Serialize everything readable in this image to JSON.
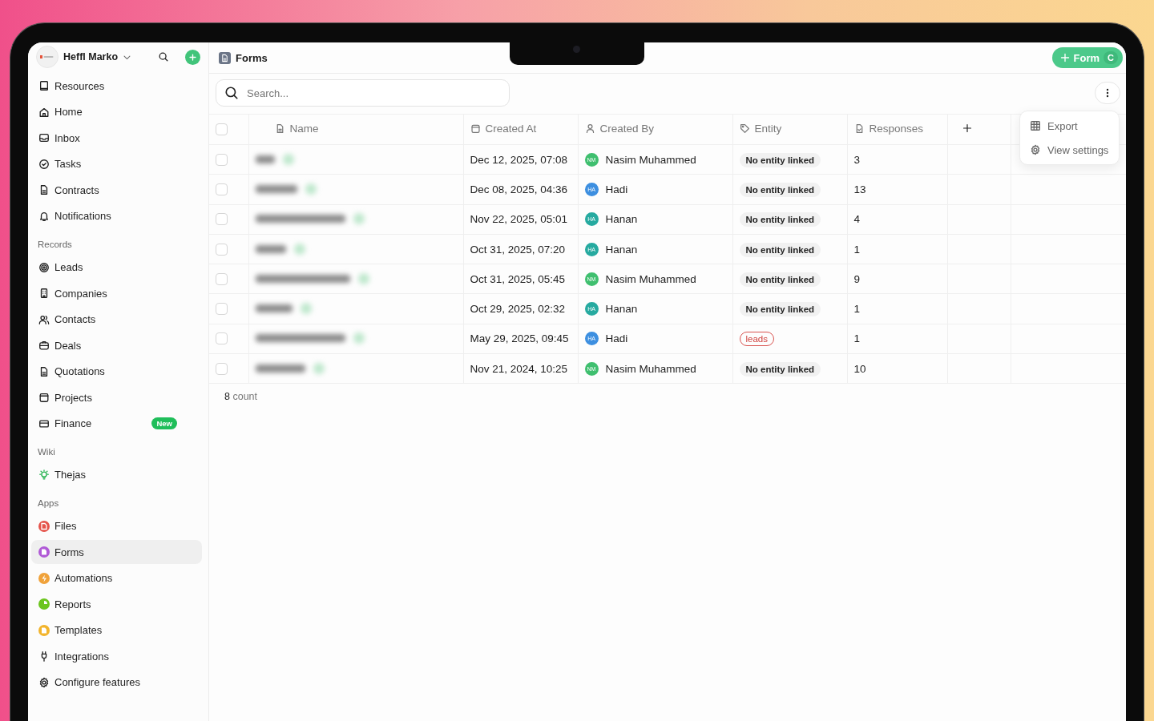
{
  "sidebar": {
    "workspace": {
      "name": "Heffl Marko"
    },
    "items": [
      {
        "label": "Resources",
        "selected": false
      },
      {
        "label": "Home",
        "selected": false
      },
      {
        "label": "Inbox",
        "selected": false
      },
      {
        "label": "Tasks",
        "selected": false
      },
      {
        "label": "Contracts",
        "selected": false
      },
      {
        "label": "Notifications",
        "selected": false
      }
    ],
    "sections": [
      {
        "title": "Records",
        "items": [
          {
            "label": "Leads",
            "selected": false
          },
          {
            "label": "Companies",
            "selected": false
          },
          {
            "label": "Contacts",
            "selected": false
          },
          {
            "label": "Deals",
            "selected": false
          },
          {
            "label": "Quotations",
            "selected": false
          },
          {
            "label": "Projects",
            "selected": false
          },
          {
            "label": "Finance",
            "selected": false,
            "badge": "New"
          }
        ]
      },
      {
        "title": "Wiki",
        "items": [
          {
            "label": "Thejas",
            "selected": false
          }
        ]
      },
      {
        "title": "Apps",
        "items": [
          {
            "label": "Files",
            "selected": false,
            "color": "#e5534b"
          },
          {
            "label": "Forms",
            "selected": true,
            "color": "#b05ad6"
          },
          {
            "label": "Automations",
            "selected": false,
            "color": "#f0a23a"
          },
          {
            "label": "Reports",
            "selected": false,
            "color": "#6cc51e"
          },
          {
            "label": "Templates",
            "selected": false,
            "color": "#f2b42c"
          },
          {
            "label": "Integrations",
            "selected": false
          },
          {
            "label": "Configure features",
            "selected": false
          }
        ]
      }
    ]
  },
  "header": {
    "title": "Forms",
    "new_button": "Form",
    "shortcut": "C"
  },
  "search": {
    "placeholder": "Search..."
  },
  "menu": {
    "items": [
      "Export",
      "View settings"
    ]
  },
  "table": {
    "all_checked": false,
    "columns": [
      "Name",
      "Created At",
      "Created By",
      "Entity",
      "Responses"
    ],
    "rows": [
      {
        "checked": false,
        "created_at": "Dec 12, 2025, 07:08",
        "initials": "NM",
        "creator": "Nasim Muhammed",
        "color": "#3fbf6f",
        "entity": {
          "kind": "none",
          "label": "No entity linked"
        },
        "responses": "3"
      },
      {
        "checked": false,
        "created_at": "Dec 08, 2025, 04:36",
        "initials": "HA",
        "creator": "Hadi",
        "color": "#3d8fe0",
        "entity": {
          "kind": "none",
          "label": "No entity linked"
        },
        "responses": "13"
      },
      {
        "checked": false,
        "created_at": "Nov 22, 2025, 05:01",
        "initials": "HA",
        "creator": "Hanan",
        "color": "#26aaa0",
        "entity": {
          "kind": "none",
          "label": "No entity linked"
        },
        "responses": "4"
      },
      {
        "checked": false,
        "created_at": "Oct 31, 2025, 07:20",
        "initials": "HA",
        "creator": "Hanan",
        "color": "#26aaa0",
        "entity": {
          "kind": "none",
          "label": "No entity linked"
        },
        "responses": "1"
      },
      {
        "checked": false,
        "created_at": "Oct 31, 2025, 05:45",
        "initials": "NM",
        "creator": "Nasim Muhammed",
        "color": "#3fbf6f",
        "entity": {
          "kind": "none",
          "label": "No entity linked"
        },
        "responses": "9"
      },
      {
        "checked": false,
        "created_at": "Oct 29, 2025, 02:32",
        "initials": "HA",
        "creator": "Hanan",
        "color": "#26aaa0",
        "entity": {
          "kind": "none",
          "label": "No entity linked"
        },
        "responses": "1"
      },
      {
        "checked": false,
        "created_at": "May 29, 2025, 09:45",
        "initials": "HA",
        "creator": "Hadi",
        "color": "#3d8fe0",
        "entity": {
          "kind": "tag",
          "label": "leads"
        },
        "responses": "1"
      },
      {
        "checked": false,
        "created_at": "Nov 21, 2024, 10:25",
        "initials": "NM",
        "creator": "Nasim Muhammed",
        "color": "#3fbf6f",
        "entity": {
          "kind": "none",
          "label": "No entity linked"
        },
        "responses": "10"
      }
    ],
    "footer_count": "8",
    "footer_label": "count"
  }
}
